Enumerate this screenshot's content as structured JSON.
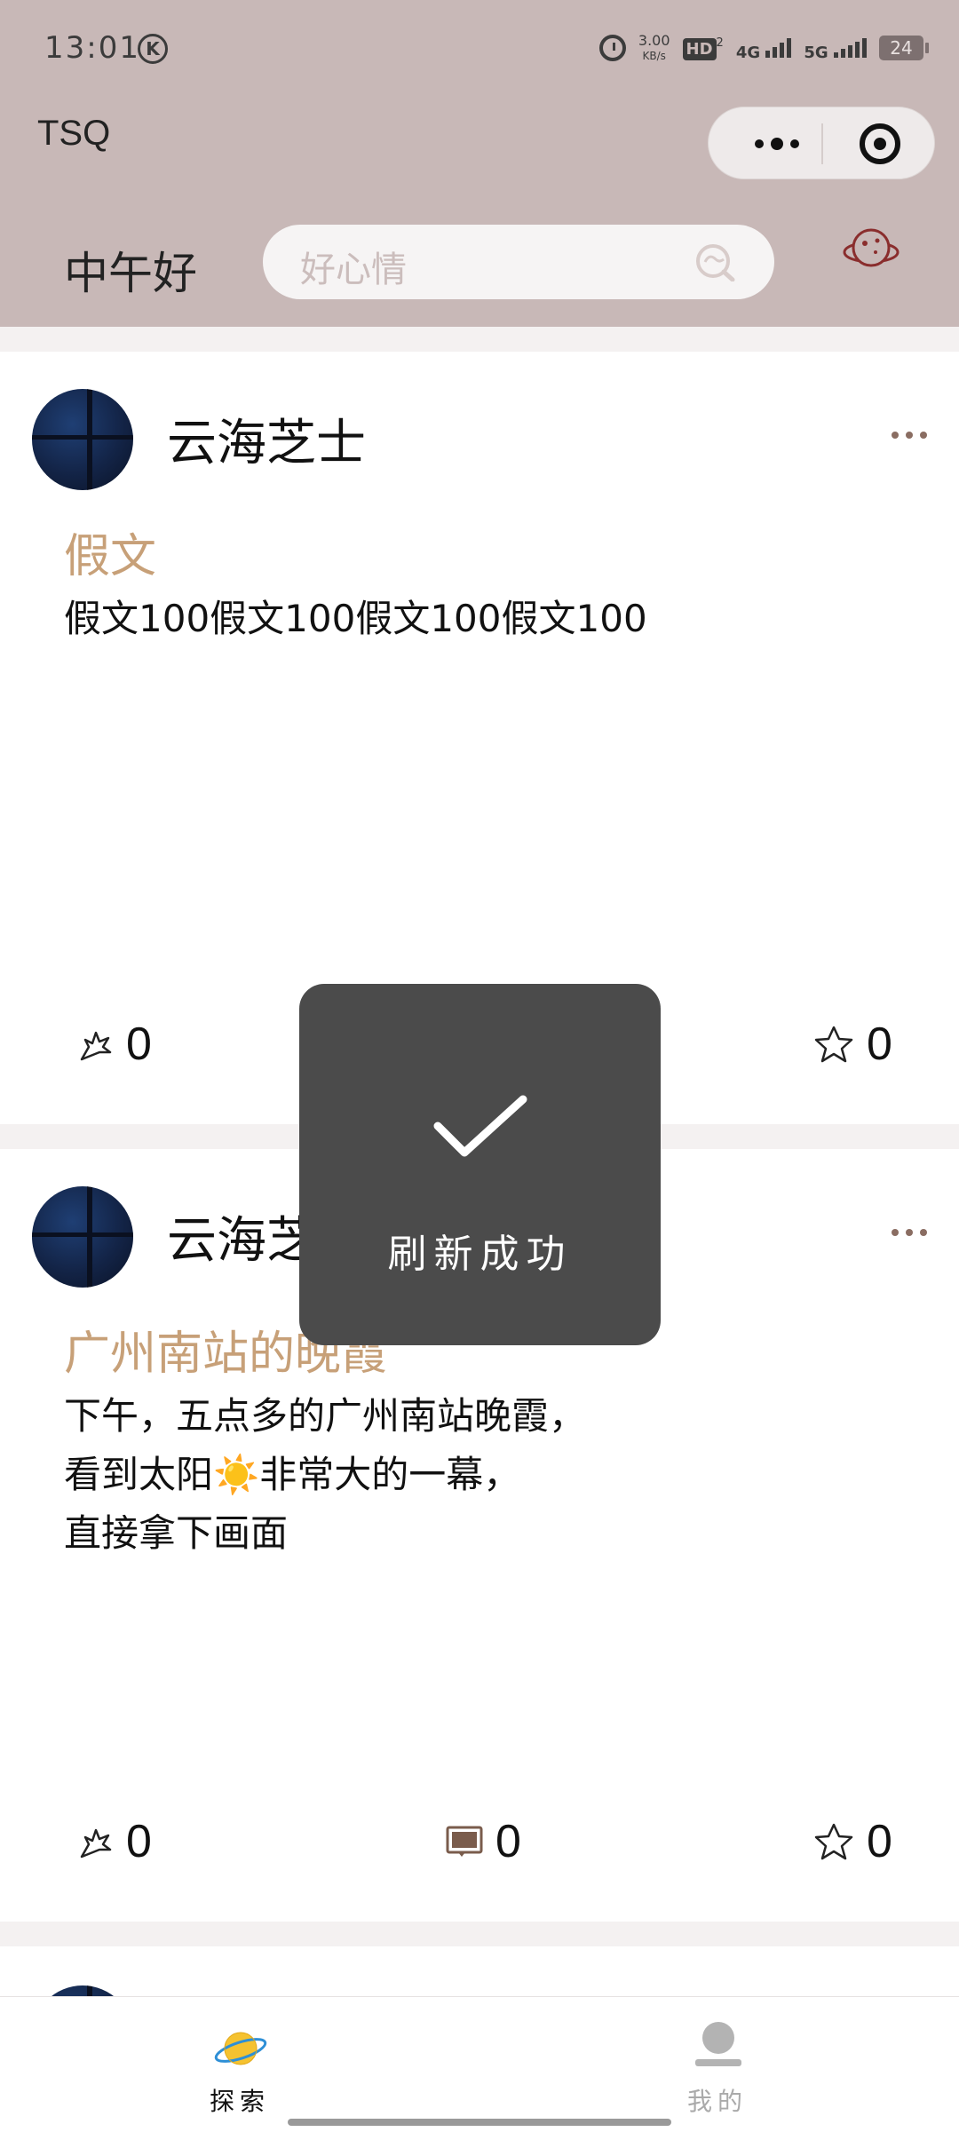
{
  "status_bar": {
    "time": "13:01",
    "k_icon": "K",
    "net_speed_value": "3.00",
    "net_speed_unit": "KB/s",
    "hd_label": "HD",
    "hd_sub": "2",
    "sig1": "4G",
    "sig2": "5G",
    "battery": "24"
  },
  "app": {
    "title": "TSQ"
  },
  "header": {
    "greeting": "中午好",
    "search_placeholder": "好心情"
  },
  "posts": [
    {
      "username": "云海芝士",
      "title": "假文",
      "body": "假文100假文100假文100假文100",
      "likes": "0",
      "comments": "",
      "stars": "0"
    },
    {
      "username": "云海芝士",
      "title": "广州南站的晚霞",
      "body": "下午，五点多的广州南站晚霞，\n看到太阳☀️非常大的一幕，\n直接拿下画面",
      "likes": "0",
      "comments": "0",
      "stars": "0"
    }
  ],
  "toast": {
    "message": "刷新成功"
  },
  "tabs": [
    {
      "label": "探索",
      "icon": "planet-icon"
    },
    {
      "label": "我的",
      "icon": "user-icon"
    }
  ],
  "colors": {
    "header_bg": "#c8b8b7",
    "accent_title": "#c7a078",
    "toast_bg": "#4b4b4b"
  }
}
